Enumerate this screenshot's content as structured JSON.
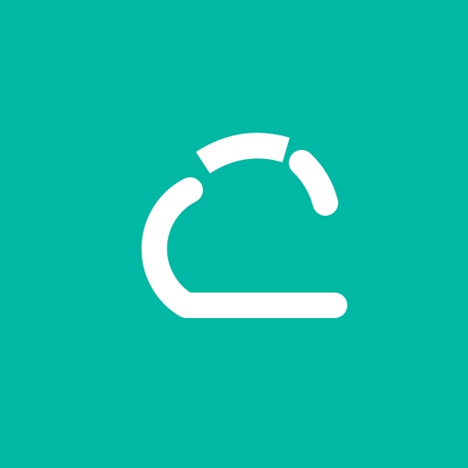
{
  "app_icon": {
    "background_color": "#00B8A4",
    "glyph_color": "#FFFFFF",
    "icon": "cloud-icon"
  }
}
